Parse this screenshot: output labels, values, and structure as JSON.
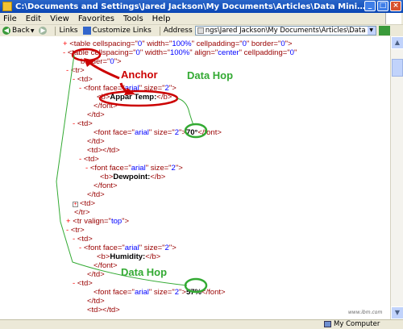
{
  "window": {
    "title": "C:\\Documents and Settings\\Jared Jackson\\My Documents\\Articles\\Data Mining Article\\seattle.xml - Microsoft Internet Expl..."
  },
  "menu": [
    "File",
    "Edit",
    "View",
    "Favorites",
    "Tools",
    "Help"
  ],
  "toolbar": {
    "back_label": "Back",
    "links_label": "Links",
    "customize_links_label": "Customize Links",
    "address_label": "Address",
    "address_value": "ngs\\Jared Jackson\\My Documents\\Articles\\Data Mining Article\\seattle.xml"
  },
  "xml_lines": [
    {
      "toggle": "+",
      "parts": [
        {
          "c": "tag",
          "t": "<table "
        },
        {
          "c": "attr",
          "t": "cellspacing=\""
        },
        {
          "c": "val",
          "t": "0"
        },
        {
          "c": "attr",
          "t": "\" width=\""
        },
        {
          "c": "val",
          "t": "100%"
        },
        {
          "c": "attr",
          "t": "\" cellpadding=\""
        },
        {
          "c": "val",
          "t": "0"
        },
        {
          "c": "attr",
          "t": "\" border=\""
        },
        {
          "c": "val",
          "t": "0"
        },
        {
          "c": "tag",
          "t": "\">"
        }
      ]
    },
    {
      "toggle": "-",
      "parts": [
        {
          "c": "tag",
          "t": "<table "
        },
        {
          "c": "attr",
          "t": "cellspacing=\""
        },
        {
          "c": "val",
          "t": "0"
        },
        {
          "c": "attr",
          "t": "\" width=\""
        },
        {
          "c": "val",
          "t": "100%"
        },
        {
          "c": "attr",
          "t": "\" align=\""
        },
        {
          "c": "val",
          "t": "center"
        },
        {
          "c": "attr",
          "t": "\" cellpadding=\""
        },
        {
          "c": "val",
          "t": "0"
        },
        {
          "c": "tag",
          "t": "\""
        }
      ]
    },
    {
      "toggle": "",
      "parts": [
        {
          "c": "attr",
          "t": "border=\""
        },
        {
          "c": "val",
          "t": "0"
        },
        {
          "c": "tag",
          "t": "\">"
        }
      ]
    },
    {
      "toggle": "-",
      "parts": [
        {
          "c": "tag",
          "t": "<tr>"
        }
      ]
    },
    {
      "toggle": "-",
      "parts": [
        {
          "c": "tag",
          "t": "<td>"
        }
      ]
    },
    {
      "toggle": "-",
      "parts": [
        {
          "c": "tag",
          "t": "<font "
        },
        {
          "c": "attr",
          "t": "face=\""
        },
        {
          "c": "val",
          "t": "arial"
        },
        {
          "c": "attr",
          "t": "\" size=\""
        },
        {
          "c": "val",
          "t": "2"
        },
        {
          "c": "tag",
          "t": "\">"
        }
      ]
    },
    {
      "toggle": "",
      "parts": [
        {
          "c": "tag",
          "t": "<b>"
        },
        {
          "c": "txtc",
          "t": "Appar Temp:"
        },
        {
          "c": "tag",
          "t": "</b>"
        }
      ]
    },
    {
      "toggle": "",
      "parts": [
        {
          "c": "tag",
          "t": "</font>"
        }
      ]
    },
    {
      "toggle": "",
      "parts": [
        {
          "c": "tag",
          "t": "</td>"
        }
      ]
    },
    {
      "toggle": "-",
      "parts": [
        {
          "c": "tag",
          "t": "<td>"
        }
      ]
    },
    {
      "toggle": "",
      "parts": [
        {
          "c": "tag",
          "t": "<font "
        },
        {
          "c": "attr",
          "t": "face=\""
        },
        {
          "c": "val",
          "t": "arial"
        },
        {
          "c": "attr",
          "t": "\" size=\""
        },
        {
          "c": "val",
          "t": "2"
        },
        {
          "c": "tag",
          "t": "\">"
        },
        {
          "c": "txtc",
          "t": "70°"
        },
        {
          "c": "tag",
          "t": "</font>"
        }
      ]
    },
    {
      "toggle": "",
      "parts": [
        {
          "c": "tag",
          "t": "</td>"
        }
      ]
    },
    {
      "toggle": "",
      "parts": [
        {
          "c": "tag",
          "t": "<td></td>"
        }
      ]
    },
    {
      "toggle": "-",
      "parts": [
        {
          "c": "tag",
          "t": "<td>"
        }
      ]
    },
    {
      "toggle": "-",
      "parts": [
        {
          "c": "tag",
          "t": "<font "
        },
        {
          "c": "attr",
          "t": "face=\""
        },
        {
          "c": "val",
          "t": "arial"
        },
        {
          "c": "attr",
          "t": "\" size=\""
        },
        {
          "c": "val",
          "t": "2"
        },
        {
          "c": "tag",
          "t": "\">"
        }
      ]
    },
    {
      "toggle": "",
      "parts": [
        {
          "c": "tag",
          "t": "<b>"
        },
        {
          "c": "txtc",
          "t": "Dewpoint:"
        },
        {
          "c": "tag",
          "t": "</b>"
        }
      ]
    },
    {
      "toggle": "",
      "parts": [
        {
          "c": "tag",
          "t": "</font>"
        }
      ]
    },
    {
      "toggle": "",
      "parts": [
        {
          "c": "tag",
          "t": "</td>"
        }
      ]
    },
    {
      "toggle": "+box",
      "parts": [
        {
          "c": "tag",
          "t": "<td>"
        }
      ]
    },
    {
      "toggle": "",
      "parts": [
        {
          "c": "tag",
          "t": "</tr>"
        }
      ]
    },
    {
      "toggle": "+",
      "parts": [
        {
          "c": "tag",
          "t": "<tr "
        },
        {
          "c": "attr",
          "t": "valign=\""
        },
        {
          "c": "val",
          "t": "top"
        },
        {
          "c": "tag",
          "t": "\">"
        }
      ]
    },
    {
      "toggle": "-",
      "parts": [
        {
          "c": "tag",
          "t": "<tr>"
        }
      ]
    },
    {
      "toggle": "-",
      "parts": [
        {
          "c": "tag",
          "t": "<td>"
        }
      ]
    },
    {
      "toggle": "-",
      "parts": [
        {
          "c": "tag",
          "t": "<font "
        },
        {
          "c": "attr",
          "t": "face=\""
        },
        {
          "c": "val",
          "t": "arial"
        },
        {
          "c": "attr",
          "t": "\" size=\""
        },
        {
          "c": "val",
          "t": "2"
        },
        {
          "c": "tag",
          "t": "\">"
        }
      ]
    },
    {
      "toggle": "",
      "parts": [
        {
          "c": "tag",
          "t": "<b>"
        },
        {
          "c": "txtc",
          "t": "Humidity:"
        },
        {
          "c": "tag",
          "t": "</b>"
        }
      ]
    },
    {
      "toggle": "",
      "parts": [
        {
          "c": "tag",
          "t": "</font>"
        }
      ]
    },
    {
      "toggle": "",
      "parts": [
        {
          "c": "tag",
          "t": "</td>"
        }
      ]
    },
    {
      "toggle": "-",
      "parts": [
        {
          "c": "tag",
          "t": "<td>"
        }
      ]
    },
    {
      "toggle": "",
      "parts": [
        {
          "c": "tag",
          "t": "<font "
        },
        {
          "c": "attr",
          "t": "face=\""
        },
        {
          "c": "val",
          "t": "arial"
        },
        {
          "c": "attr",
          "t": "\" size=\""
        },
        {
          "c": "val",
          "t": "2"
        },
        {
          "c": "tag",
          "t": "\">"
        },
        {
          "c": "txtc",
          "t": "57%"
        },
        {
          "c": "tag",
          "t": "</font>"
        }
      ]
    },
    {
      "toggle": "",
      "parts": [
        {
          "c": "tag",
          "t": "</td>"
        }
      ]
    },
    {
      "toggle": "",
      "parts": [
        {
          "c": "tag",
          "t": "<td></td>"
        }
      ]
    }
  ],
  "annotations": {
    "anchor": "Anchor",
    "data_hop_1": "Data Hop",
    "data_hop_2": "Data Hop",
    "red_color": "#cc0000",
    "green_color": "#33aa33"
  },
  "status": {
    "zone": "My Computer"
  },
  "watermark": "www.ibm.com"
}
